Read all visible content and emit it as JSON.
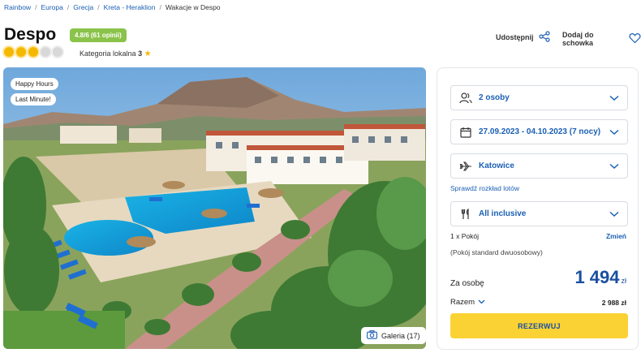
{
  "breadcrumb": {
    "items": [
      "Rainbow",
      "Europa",
      "Grecja",
      "Kreta - Heraklion"
    ],
    "current": "Wakacje w Despo"
  },
  "hotel": {
    "name": "Despo",
    "rating_badge": "4.8/6 (61 opinii)",
    "stars_filled": 3,
    "stars_total": 5,
    "category_label": "Kategoria lokalna",
    "category_value": "3"
  },
  "actions": {
    "share_label": "Udostępnij",
    "favorite_label": "Dodaj do schowka"
  },
  "photo": {
    "tags": [
      "Happy Hours",
      "Last Minute!"
    ],
    "gallery_label": "Galeria (17)"
  },
  "booking": {
    "persons": "2 osoby",
    "dates": "27.09.2023 - 04.10.2023 (7 nocy)",
    "departure": "Katowice",
    "flight_schedule_link": "Sprawdź rozkład lotów",
    "board": "All inclusive",
    "room_count": "1 x Pokój",
    "change_label": "Zmień",
    "room_description": "(Pokój standard dwuosobowy)",
    "per_person_label": "Za osobę",
    "price": "1 494",
    "currency": "zł",
    "total_label": "Razem",
    "total_value": "2 988 zł",
    "book_label": "REZERWUJ"
  },
  "colors": {
    "accent": "#1a5fb4",
    "badge": "#8bc34a",
    "book_button": "#fbd234",
    "price": "#1a4fa0"
  }
}
